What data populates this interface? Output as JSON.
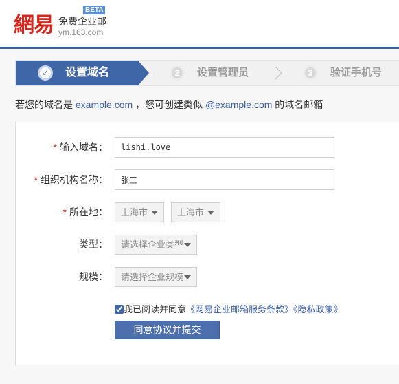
{
  "brand": {
    "logo_text": "網易",
    "product_name": "免费企业邮",
    "domain_text": "ym.163.com",
    "beta_badge": "BETA"
  },
  "steps": [
    {
      "number": "✓",
      "label": "设置域名",
      "state": "active"
    },
    {
      "number": "2",
      "label": "设置管理员",
      "state": "todo"
    },
    {
      "number": "3",
      "label": "验证手机号",
      "state": "todo"
    }
  ],
  "intro": {
    "part1": "若您的域名是 ",
    "example_domain": "example.com",
    "part2": " ，您可创建类似 ",
    "example_address": "@example.com",
    "part3": " 的域名邮箱"
  },
  "form": {
    "required_mark": "*",
    "domain": {
      "label": "输入域名：",
      "value": "lishi.love"
    },
    "org_name": {
      "label": "组织机构名称：",
      "value": "张三"
    },
    "location": {
      "label": "所在地：",
      "province": "上海市",
      "city": "上海市"
    },
    "type": {
      "label": "类型：",
      "placeholder": "请选择企业类型"
    },
    "scale": {
      "label": "规模：",
      "placeholder": "请选择企业规模"
    },
    "agree": {
      "checked": true,
      "text": "我已阅读并同意",
      "terms_link": "《网易企业邮箱服务条款》",
      "privacy_link": "《隐私政策》"
    },
    "submit_label": "同意协议并提交"
  },
  "colors": {
    "brand_red": "#d7261e",
    "accent_blue": "#3f67a8",
    "link_blue": "#3a5ea8",
    "button_blue": "#4e6fad"
  }
}
